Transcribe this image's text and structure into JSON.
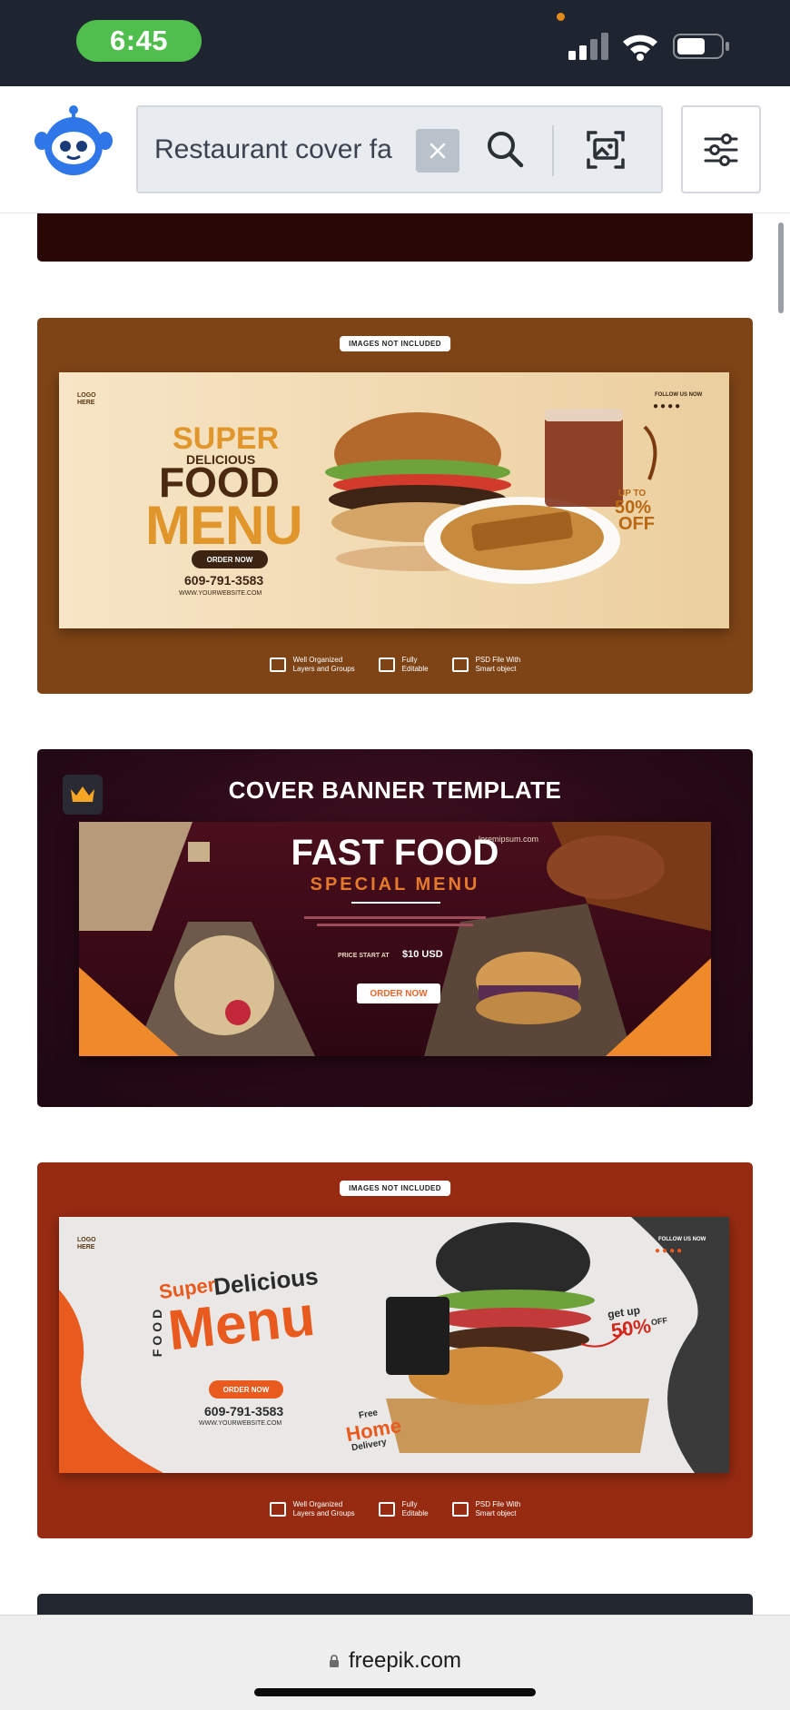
{
  "status_bar": {
    "time": "6:45"
  },
  "header": {
    "logo_icon": "robot-mascot-icon",
    "search": {
      "value": "Restaurant cover fa",
      "clear_icon": "close-icon",
      "search_icon": "search-icon",
      "visual_search_icon": "image-search-icon"
    },
    "filter_icon": "sliders-icon"
  },
  "results": [
    {
      "badge": "IMAGES NOT INCLUDED",
      "logo": "LOGO\nHERE",
      "headline_1": "SUPER",
      "headline_2": "DELICIOUS",
      "headline_3": "FOOD",
      "headline_4": "MENU",
      "cta": "ORDER NOW",
      "phone": "609-791-3583",
      "website": "WWW.YOURWEBSITE.COM",
      "follow": "FOLLOW US NOW",
      "offer_top": "UP TO",
      "offer_pct": "50%",
      "offer_bottom": "OFF",
      "features": [
        {
          "line1": "Well Organized",
          "line2": "Layers and Groups"
        },
        {
          "line1": "Fully",
          "line2": "Editable"
        },
        {
          "line1": "PSD File With",
          "line2": "Smart object"
        }
      ]
    },
    {
      "premium_icon": "crown-icon",
      "title": "COVER BANNER TEMPLATE",
      "headline": "FAST FOOD",
      "subheadline": "SPECIAL MENU",
      "site": "loremipsum.com",
      "price_label": "PRICE START AT",
      "price": "$10 USD",
      "cta": "ORDER NOW"
    },
    {
      "badge": "IMAGES NOT INCLUDED",
      "logo": "LOGO\nHERE",
      "side": "FOOD",
      "headline_1": "Super",
      "headline_2": "Delicious",
      "headline_3": "Menu",
      "cta": "ORDER NOW",
      "phone": "609-791-3583",
      "website": "WWW.YOURWEBSITE.COM",
      "follow": "FOLLOW US NOW",
      "offer_top": "get up",
      "offer_pct": "50%",
      "offer_bottom": "OFF",
      "delivery_1": "Free",
      "delivery_2": "Home",
      "delivery_3": "Delivery",
      "features": [
        {
          "line1": "Well Organized",
          "line2": "Layers and Groups"
        },
        {
          "line1": "Fully",
          "line2": "Editable"
        },
        {
          "line1": "PSD File With",
          "line2": "Smart object"
        }
      ]
    }
  ],
  "browser": {
    "url": "freepik.com"
  },
  "colors": {
    "status_bg": "#1f2530",
    "time_pill": "#4fbe4c",
    "brand_blue": "#2f77e8",
    "card_brown": "#7e4416",
    "card_red": "#962b12",
    "accent_orange": "#e9a233"
  }
}
